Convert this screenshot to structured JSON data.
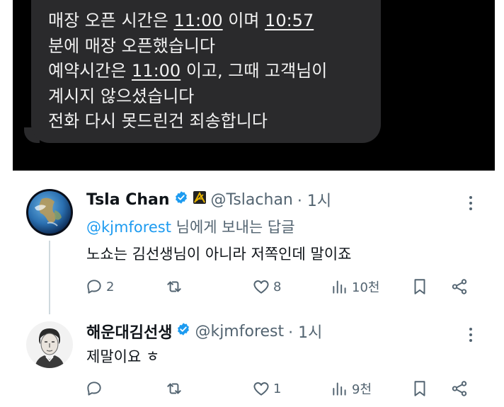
{
  "message": {
    "line1": {
      "a": "매장 오픈 시간은 ",
      "t1": "11:00",
      "b": " 이며 ",
      "t2": "10:57"
    },
    "line2": "분에 매장 오픈했습니다",
    "line3": {
      "a": "예약시간은 ",
      "t1": "11:00",
      "b": " 이고, 그때 고객님이"
    },
    "line4": "계시지 않으셨습니다",
    "line5": "전화 다시 못드린건 죄송합니다"
  },
  "tweets": [
    {
      "name": "Tsla Chan",
      "handle": "@Tslachan",
      "time": "· 1시",
      "reply_mention": "@kjmforest",
      "reply_suffix": " 님에게 보내는 답글",
      "text": "노쇼는 김선생님이 아니라 저쪽인데 말이죠",
      "stats": {
        "replies": "2",
        "retweets": "",
        "likes": "8",
        "views": "10천"
      }
    },
    {
      "name": "해운대김선생",
      "handle": "@kjmforest",
      "time": "· 1시",
      "text": "제말이요 ㅎ",
      "stats": {
        "replies": "",
        "retweets": "",
        "likes": "1",
        "views": "9천"
      }
    }
  ],
  "colors": {
    "verified": "#1d9bf0",
    "text": "#0f1419",
    "muted": "#536471",
    "bubble": "#2a2a2c"
  },
  "icons": [
    "verified-icon",
    "badge-icon",
    "more-icon",
    "reply-icon",
    "retweet-icon",
    "like-icon",
    "views-icon",
    "bookmark-icon",
    "share-icon"
  ]
}
